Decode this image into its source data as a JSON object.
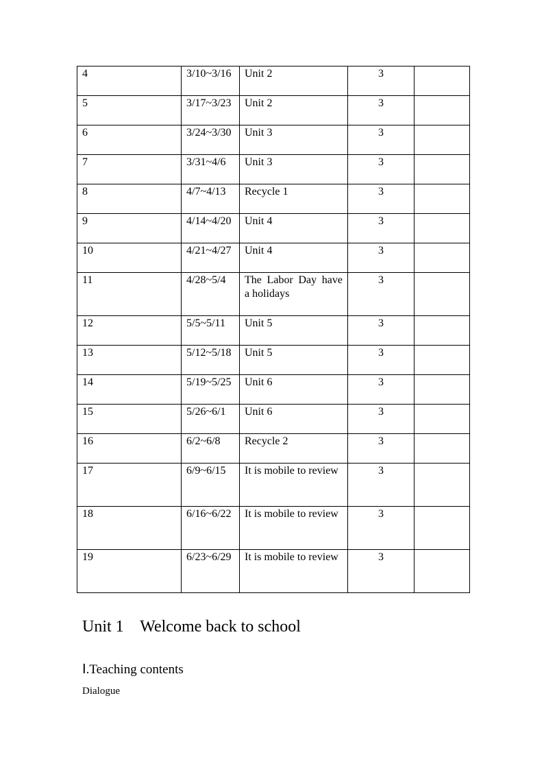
{
  "schedule": {
    "rows": [
      {
        "week": "4",
        "dates": "3/10~3/16",
        "content": "Unit 2",
        "hours": "3",
        "note": ""
      },
      {
        "week": "5",
        "dates": "3/17~3/23",
        "content": "Unit 2",
        "hours": "3",
        "note": ""
      },
      {
        "week": "6",
        "dates": "3/24~3/30",
        "content": "Unit 3",
        "hours": "3",
        "note": ""
      },
      {
        "week": "7",
        "dates": "3/31~4/6",
        "content": "Unit 3",
        "hours": "3",
        "note": ""
      },
      {
        "week": "8",
        "dates": "4/7~4/13",
        "content": "Recycle 1",
        "hours": "3",
        "note": ""
      },
      {
        "week": "9",
        "dates": "4/14~4/20",
        "content": "Unit 4",
        "hours": "3",
        "note": ""
      },
      {
        "week": "10",
        "dates": "4/21~4/27",
        "content": "Unit 4",
        "hours": "3",
        "note": ""
      },
      {
        "week": "11",
        "dates": "4/28~5/4",
        "content": "The Labor Day have a holidays",
        "hours": "3",
        "note": ""
      },
      {
        "week": "12",
        "dates": "5/5~5/11",
        "content": "Unit 5",
        "hours": "3",
        "note": ""
      },
      {
        "week": "13",
        "dates": "5/12~5/18",
        "content": "Unit 5",
        "hours": "3",
        "note": ""
      },
      {
        "week": "14",
        "dates": "5/19~5/25",
        "content": "Unit 6",
        "hours": "3",
        "note": ""
      },
      {
        "week": "15",
        "dates": "5/26~6/1",
        "content": "Unit 6",
        "hours": "3",
        "note": ""
      },
      {
        "week": "16",
        "dates": "6/2~6/8",
        "content": "Recycle 2",
        "hours": "3",
        "note": ""
      },
      {
        "week": "17",
        "dates": "6/9~6/15",
        "content": "It is mobile to review",
        "hours": "3",
        "note": ""
      },
      {
        "week": "18",
        "dates": "6/16~6/22",
        "content": "It is mobile to review",
        "hours": "3",
        "note": ""
      },
      {
        "week": "19",
        "dates": "6/23~6/29",
        "content": "It is mobile to review",
        "hours": "3",
        "note": ""
      }
    ]
  },
  "unit_title": "Unit 1    Welcome back to school",
  "section_title": "Ⅰ.Teaching contents",
  "sub_label": "Dialogue"
}
